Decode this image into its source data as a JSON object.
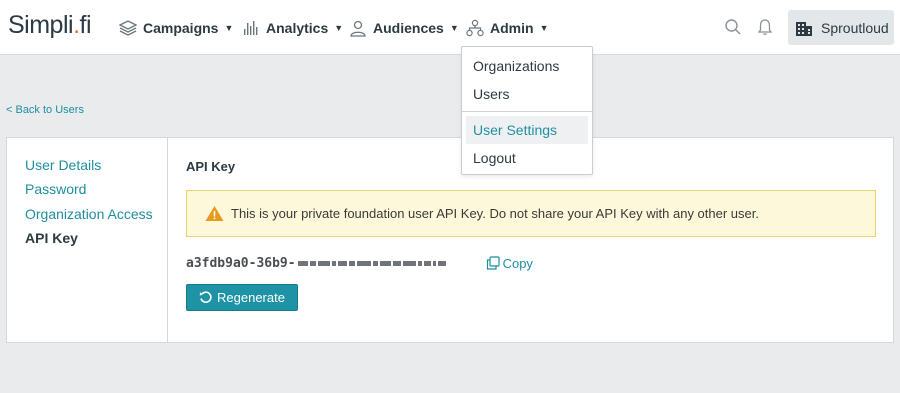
{
  "brand": {
    "logo_main": "Simpli",
    "logo_dot": ".",
    "logo_tail": "fi",
    "accent": "#1f8ea0",
    "orange": "#e8772e"
  },
  "nav": {
    "campaigns": {
      "label": "Campaigns",
      "icon": "layers-icon"
    },
    "analytics": {
      "label": "Analytics",
      "icon": "bar-chart-icon"
    },
    "audiences": {
      "label": "Audiences",
      "icon": "users-icon"
    },
    "admin": {
      "label": "Admin",
      "icon": "org-chart-icon"
    }
  },
  "header_right": {
    "org_name": "Sproutloud",
    "org_icon": "building-icon"
  },
  "admin_menu": {
    "items": [
      "Organizations",
      "Users",
      "User Settings",
      "Logout"
    ],
    "selected": "User Settings"
  },
  "back_link": "< Back to Users",
  "sidebar": {
    "items": [
      "User Details",
      "Password",
      "Organization Access",
      "API Key"
    ],
    "active": "API Key"
  },
  "api_key_section": {
    "title": "API Key",
    "warning": "This is your private foundation user API Key. Do not share your API Key with any other user.",
    "key_visible": "a3fdb9a0-36b9-",
    "copy_label": "Copy",
    "regenerate_label": "Regenerate"
  }
}
